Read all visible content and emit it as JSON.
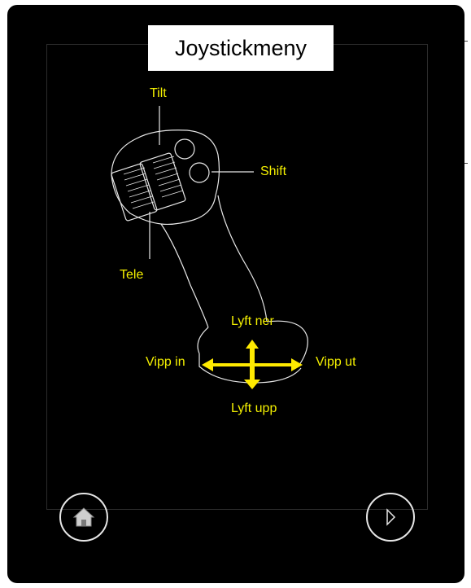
{
  "header": {
    "title": "Joystickmeny"
  },
  "labels": {
    "tilt": "Tilt",
    "shift": "Shift",
    "tele": "Tele",
    "lift_down": "Lyft ner",
    "lift_up": "Lyft upp",
    "tilt_in": "Vipp in",
    "tilt_out": "Vipp ut"
  },
  "nav": {
    "home": "home-icon",
    "next": "play-icon"
  },
  "colors": {
    "label": "#f4f000",
    "background": "#000000",
    "outline": "#e6e6e6",
    "arrow": "#ffea00"
  }
}
